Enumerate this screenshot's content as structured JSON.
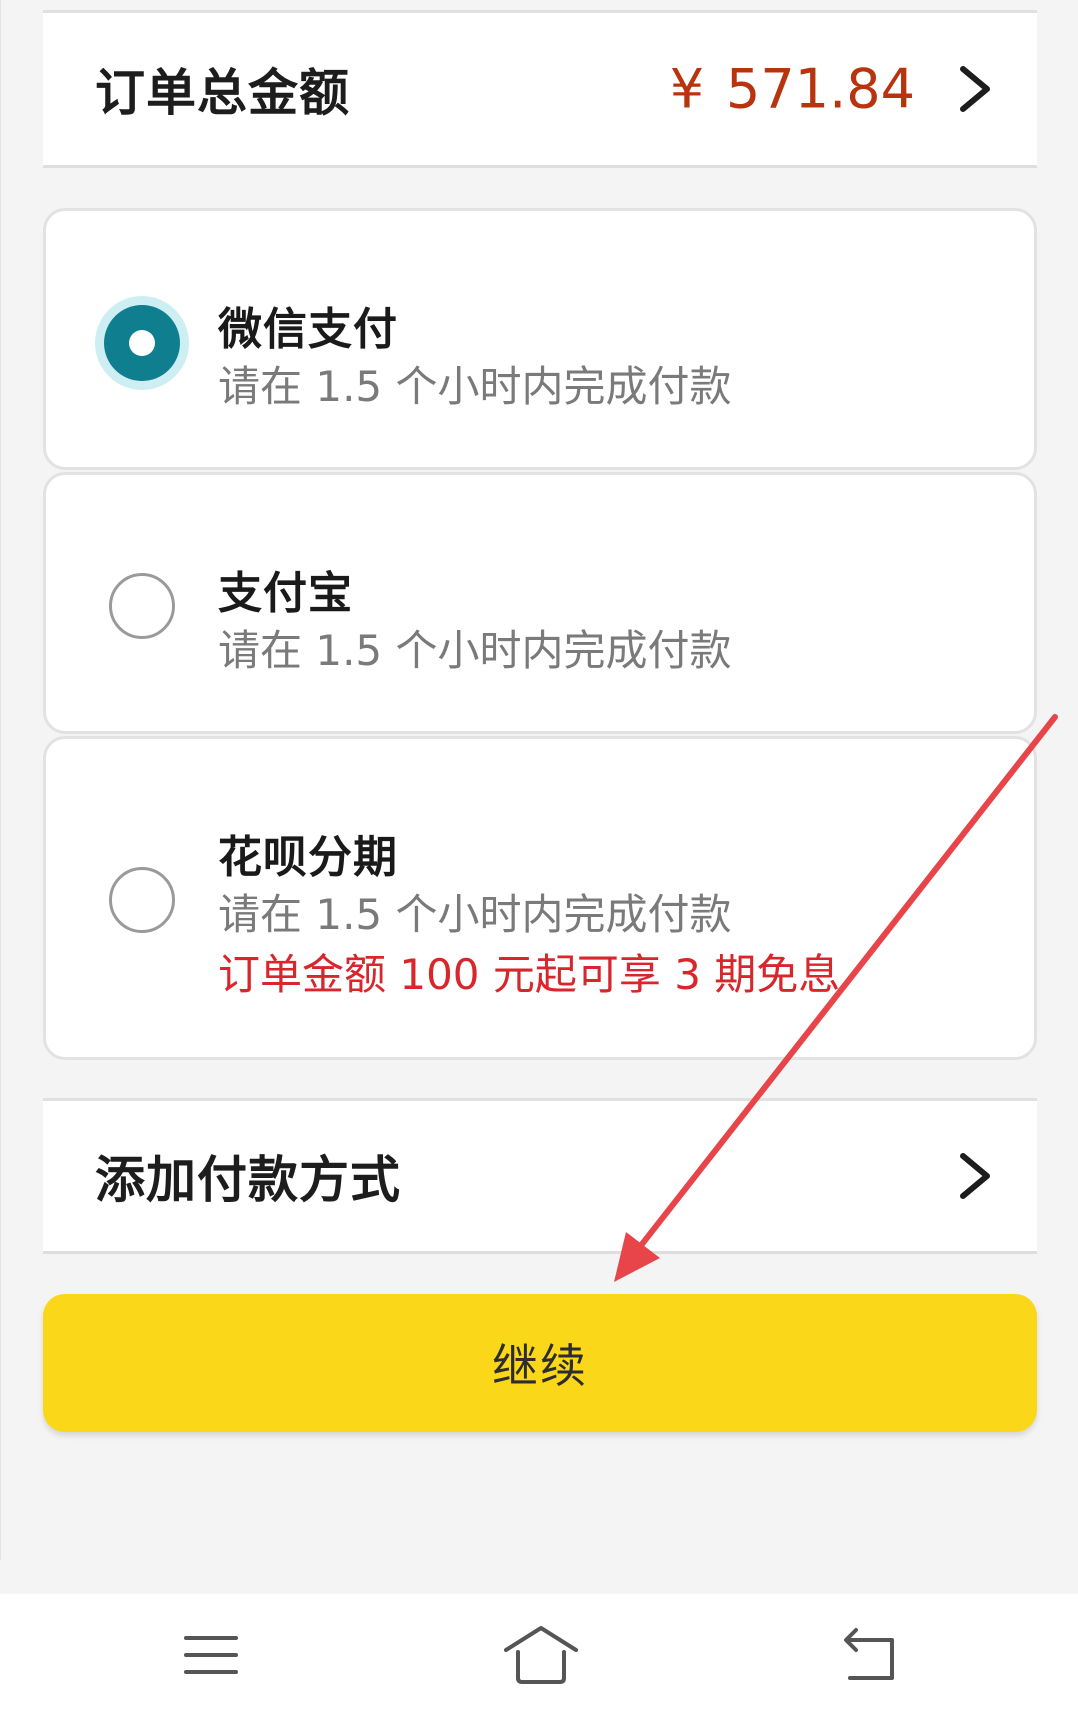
{
  "order": {
    "total_label": "订单总金额",
    "currency_symbol": "¥",
    "total_amount": "571.84"
  },
  "payment_options": [
    {
      "title": "微信支付",
      "subtitle": "请在 1.5 个小时内完成付款",
      "selected": true
    },
    {
      "title": "支付宝",
      "subtitle": "请在 1.5 个小时内完成付款",
      "selected": false
    },
    {
      "title": "花呗分期",
      "subtitle": "请在 1.5 个小时内完成付款",
      "promo": "订单金额 100 元起可享 3 期免息",
      "selected": false
    }
  ],
  "add_payment": {
    "label": "添加付款方式"
  },
  "continue_button": {
    "label": "继续"
  },
  "colors": {
    "amount": "#b8340f",
    "radio_selected": "#0f7f8f",
    "promo": "#d9262c",
    "continue_button": "#fbd71a",
    "annotation_arrow": "#e8454a"
  },
  "icons": {
    "chevron": "chevron-right-icon",
    "nav_menu": "menu-icon",
    "nav_home": "home-icon",
    "nav_back": "back-icon"
  }
}
